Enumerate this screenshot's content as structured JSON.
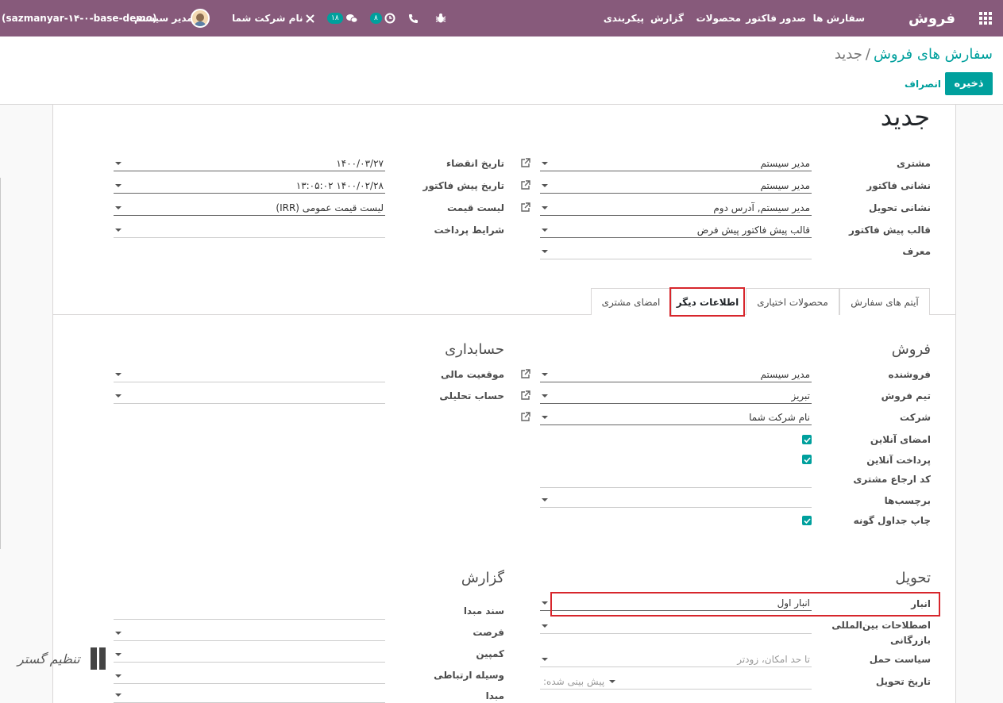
{
  "navbar": {
    "app_name": "فروش",
    "menu": [
      "سفارش ها",
      "صدور فاکتور",
      "محصولات",
      "گزارش",
      "پیکربندی"
    ],
    "messages_badge": "۱۸",
    "activities_badge": "۸",
    "company": "نام شرکت شما",
    "user": "مدیر سیستم",
    "database": "(sazmanyar-۱۴-۰-base-demo)"
  },
  "breadcrumb": {
    "parent": "سفارش های فروش",
    "separator": "/",
    "current": "جدید"
  },
  "actions": {
    "save": "ذخیره",
    "discard": "انصراف"
  },
  "form": {
    "title": "جدید",
    "customer_label": "مشتری",
    "customer": "مدیر سیستم",
    "invoice_address_label": "نشانی فاکتور",
    "invoice_address": "مدیر سیستم",
    "delivery_address_label": "نشانی تحویل",
    "delivery_address": "مدیر سیستم, آدرس دوم",
    "quotation_template_label": "قالب پیش فاکتور",
    "quotation_template": "قالب پیش فاکتور پیش فرض",
    "referrer_label": "معرف",
    "referrer": "",
    "expiration_label": "تاریخ انقضاء",
    "expiration": "۱۴۰۰/۰۳/۲۷",
    "quotation_date_label": "تاریخ پیش فاکتور",
    "quotation_date": "۱۴۰۰/۰۲/۲۸ ۱۳:۰۵:۰۲",
    "pricelist_label": "لیست قیمت",
    "pricelist": "لیست قیمت عمومی (IRR)",
    "payment_terms_label": "شرایط پرداخت",
    "payment_terms": ""
  },
  "tabs": [
    "آیتم های سفارش",
    "محصولات اختیاری",
    "اطلاعات دیگر",
    "امضای مشتری"
  ],
  "active_tab": "اطلاعات دیگر",
  "sales": {
    "title": "فروش",
    "salesperson_label": "فروشنده",
    "salesperson": "مدیر سیستم",
    "team_label": "تیم فروش",
    "team": "تبریز",
    "company_label": "شرکت",
    "company": "نام شرکت شما",
    "online_signature_label": "امضای آنلاین",
    "online_payment_label": "پرداخت آنلاین",
    "customer_reference_label": "کد ارجاع مشتری",
    "tags_label": "برچسب‌ها",
    "print_variants_label": "چاپ جداول گونه"
  },
  "accounting": {
    "title": "حسابداری",
    "fiscal_position_label": "موقعیت مالی",
    "analytic_account_label": "حساب تحلیلی"
  },
  "delivery": {
    "title": "تحویل",
    "warehouse_label": "انبار",
    "warehouse": "انبار اول",
    "incoterm_label_1": "اصطلاحات بین‌المللی",
    "incoterm_label_2": "بازرگانی",
    "shipping_policy_label": "سیاست حمل",
    "shipping_policy": "تا حد امکان، زودتر",
    "delivery_date_label": "تاریخ تحویل",
    "delivery_date_placeholder": "پیش بینی شده:"
  },
  "reporting": {
    "title": "گزارش",
    "source_document_label": "سند مبدا",
    "opportunity_label": "فرصت",
    "campaign_label": "کمپین",
    "medium_label": "وسیله ارتباطی",
    "source_label": "مبدا"
  },
  "watermark": "تنظیم گستر",
  "colors": {
    "navbar": "#875a7b",
    "accent": "#00a09d",
    "highlight": "#d7262c"
  }
}
